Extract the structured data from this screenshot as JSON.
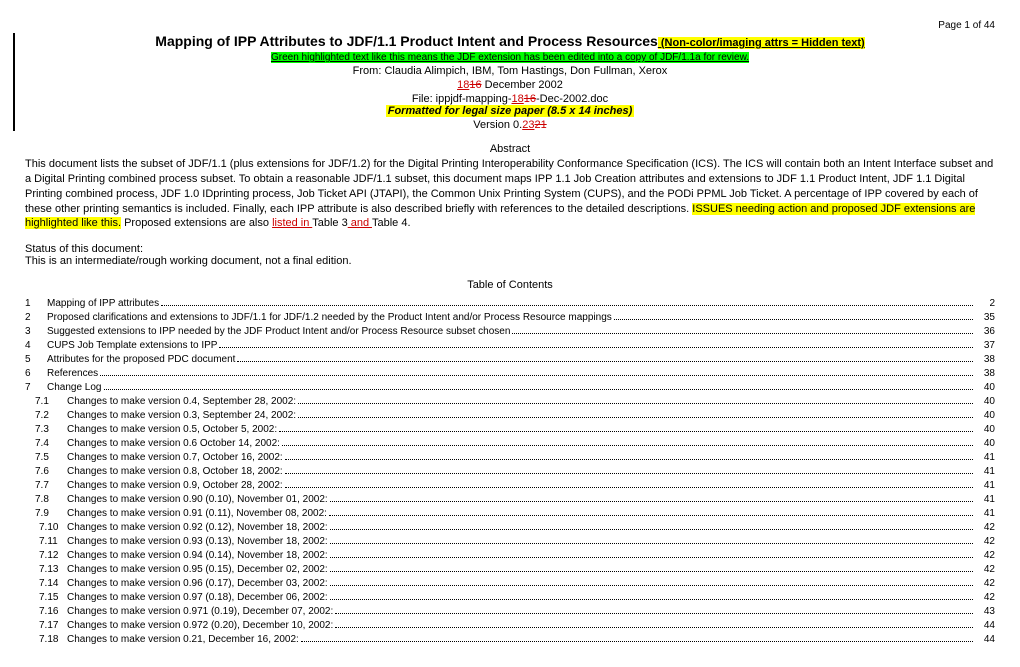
{
  "page_header": "Page 1 of 44",
  "title": "Mapping of IPP Attributes to JDF/1.1 Product Intent and Process Resources",
  "title_suffix": " (Non-color/imaging attrs = Hidden text)",
  "green_line": "Green highlighted text like this means the JDF extension has been edited into a copy of JDF/1.1a for review.",
  "from_line": "From: Claudia Alimpich, IBM, Tom Hastings, Don Fullman, Xerox",
  "date_new": "18",
  "date_old": "16",
  "date_rest": " December 2002",
  "file_pre": "File: ippjdf-mapping-",
  "file_new": "18",
  "file_old": "16",
  "file_post": "-Dec-2002.doc",
  "formatted_line": "Formatted for legal size paper (8.5 x 14 inches)",
  "version_pre": "Version  0.",
  "version_new": "23",
  "version_old": "21",
  "abstract_label": "Abstract",
  "abstract_p1": "This document lists the subset of JDF/1.1 (plus extensions for JDF/1.2) for the Digital Printing Interoperability Conformance Specification (ICS).  The ICS will contain both an Intent Interface subset and a Digital Printing combined process subset.  To obtain a reasonable JDF/1.1 subset, this document maps IPP 1.1 Job Creation attributes and extensions to JDF 1.1 Product Intent, JDF 1.1 Digital Printing combined process, JDF 1.0 IDprinting process, Job Ticket API (JTAPI),  the Common Unix Printing System (CUPS), and the PODi PPML Job Ticket.  A percentage of IPP covered by each of these other printing semantics is included.  Finally, each IPP attribute is also described briefly with references to the detailed descriptions.  ",
  "abstract_hl": "ISSUES needing action and proposed JDF extensions are highlighted like this.",
  "abstract_p2a": "  Proposed extensions are also ",
  "abstract_listed": "listed in ",
  "abstract_p2b": "Table 3",
  "abstract_and": " and ",
  "abstract_p2c": "Table 4.",
  "status_line1": "Status of this document:",
  "status_line2": "This is an intermediate/rough working document, not a final edition.",
  "toc_header": "Table of Contents",
  "toc": [
    {
      "n": "1",
      "t": "Mapping of IPP attributes",
      "p": "2",
      "lvl": 0
    },
    {
      "n": "2",
      "t": "Proposed clarifications and extensions to JDF/1.1 for JDF/1.2 needed by the Product Intent and/or Process Resource mappings",
      "p": "35",
      "lvl": 0
    },
    {
      "n": "3",
      "t": "Suggested extensions to IPP needed by the JDF Product Intent and/or Process Resource subset chosen",
      "p": "36",
      "lvl": 0
    },
    {
      "n": "4",
      "t": "CUPS Job Template extensions to IPP",
      "p": "37",
      "lvl": 0
    },
    {
      "n": "5",
      "t": "Attributes for the proposed PDC document",
      "p": "38",
      "lvl": 0
    },
    {
      "n": "6",
      "t": "References",
      "p": "38",
      "lvl": 0
    },
    {
      "n": "7",
      "t": "Change Log",
      "p": "40",
      "lvl": 0
    },
    {
      "n": "7.1",
      "t": "Changes to make version 0.4, September 28, 2002:",
      "p": "40",
      "lvl": 1
    },
    {
      "n": "7.2",
      "t": "Changes to make version 0.3, September 24, 2002:",
      "p": "40",
      "lvl": 1
    },
    {
      "n": "7.3",
      "t": "Changes to make version 0.5, October 5, 2002:",
      "p": "40",
      "lvl": 1
    },
    {
      "n": "7.4",
      "t": "Changes to make version 0.6 October 14, 2002:",
      "p": "40",
      "lvl": 1
    },
    {
      "n": "7.5",
      "t": "Changes to make version 0.7, October 16, 2002:",
      "p": "41",
      "lvl": 1
    },
    {
      "n": "7.6",
      "t": "Changes to make version 0.8, October 18, 2002:",
      "p": "41",
      "lvl": 1
    },
    {
      "n": "7.7",
      "t": "Changes to make version 0.9, October 28, 2002:",
      "p": "41",
      "lvl": 1
    },
    {
      "n": "7.8",
      "t": "Changes to make version 0.90 (0.10), November 01, 2002:",
      "p": "41",
      "lvl": 1
    },
    {
      "n": "7.9",
      "t": "Changes to make version 0.91 (0.11), November 08, 2002:",
      "p": "41",
      "lvl": 1
    },
    {
      "n": "7.10",
      "t": "Changes to make version 0.92 (0.12), November 18, 2002:",
      "p": "42",
      "lvl": 1
    },
    {
      "n": "7.11",
      "t": "Changes to make version 0.93 (0.13), November 18, 2002:",
      "p": "42",
      "lvl": 1
    },
    {
      "n": "7.12",
      "t": "Changes to make version 0.94 (0.14), November 18, 2002:",
      "p": "42",
      "lvl": 1
    },
    {
      "n": "7.13",
      "t": "Changes to make version 0.95 (0.15), December 02, 2002:",
      "p": "42",
      "lvl": 1
    },
    {
      "n": "7.14",
      "t": "Changes to make version 0.96 (0.17), December 03, 2002:",
      "p": "42",
      "lvl": 1
    },
    {
      "n": "7.15",
      "t": "Changes to make version 0.97 (0.18), December 06, 2002:",
      "p": "42",
      "lvl": 1
    },
    {
      "n": "7.16",
      "t": "Changes to make version 0.971 (0.19), December 07, 2002:",
      "p": "43",
      "lvl": 1
    },
    {
      "n": "7.17",
      "t": "Changes to make version 0.972 (0.20), December 10, 2002:",
      "p": "44",
      "lvl": 1
    },
    {
      "n": "7.18",
      "t": "Changes to make version 0.21, December 16, 2002:",
      "p": "44",
      "lvl": 1
    }
  ]
}
